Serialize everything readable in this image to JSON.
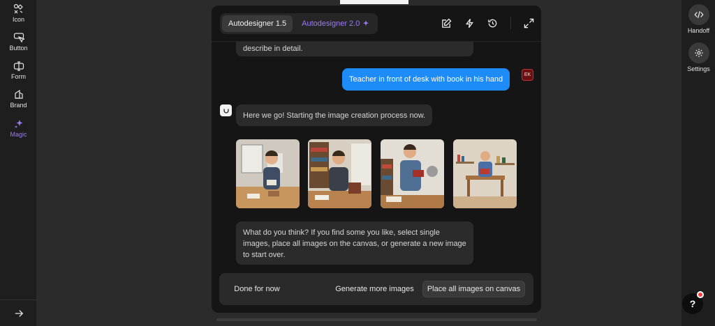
{
  "sidebar": {
    "items": [
      {
        "label": "Icon"
      },
      {
        "label": "Button"
      },
      {
        "label": "Form"
      },
      {
        "label": "Brand"
      },
      {
        "label": "Magic"
      }
    ]
  },
  "right_sidebar": {
    "handoff_label": "Handoff",
    "settings_label": "Settings",
    "help_label": "?"
  },
  "header": {
    "tab1": "Autodesigner 1.5",
    "tab2": "Autodesigner 2.0"
  },
  "chat": {
    "prev_text": "describe in detail.",
    "user_message": "Teacher in front of desk with book in his hand",
    "user_initials": "EK",
    "bot_message": "Here we go! Starting the image creation process now.",
    "followup_message": "What do you think? If you find some you like, select single images, place all images on the canvas, or generate a new image to start over."
  },
  "actions": {
    "done": "Done for now",
    "generate": "Generate more images",
    "place": "Place all images on canvas"
  },
  "colors": {
    "accent_purple": "#9d7cf5",
    "user_bubble": "#1d8cf8",
    "panel_bg": "#151515"
  }
}
